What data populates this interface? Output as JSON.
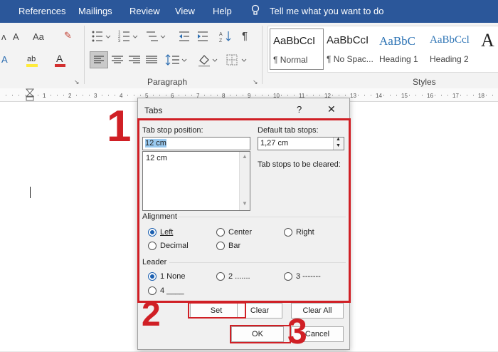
{
  "tabs": [
    "References",
    "Mailings",
    "Review",
    "View",
    "Help"
  ],
  "tell_me": "Tell me what you want to do",
  "ribbon": {
    "paragraph_label": "Paragraph",
    "styles_label": "Styles",
    "styles": [
      {
        "sample": "AaBbCcI",
        "name": "¶ Normal"
      },
      {
        "sample": "AaBbCcI",
        "name": "¶ No Spac..."
      },
      {
        "sample": "AaBbC",
        "name": "Heading 1"
      },
      {
        "sample": "AaBbCcl",
        "name": "Heading 2"
      },
      {
        "sample": "A",
        "name": ""
      }
    ],
    "font_aa": "Aa",
    "font_a": "A",
    "pilcrow": "¶"
  },
  "dialog": {
    "title": "Tabs",
    "help": "?",
    "close": "✕",
    "tab_stop_label": "Tab stop position:",
    "tab_stop_value": "12 cm",
    "tab_stop_list": [
      "12 cm"
    ],
    "default_label": "Default tab stops:",
    "default_value": "1,27 cm",
    "cleared_label": "Tab stops to be cleared:",
    "alignment_label": "Alignment",
    "alignment": [
      "Left",
      "Center",
      "Right",
      "Decimal",
      "Bar"
    ],
    "leader_label": "Leader",
    "leader": [
      "1 None",
      "2 .......",
      "3 -------",
      "4 ____"
    ],
    "set": "Set",
    "clear": "Clear",
    "clear_all": "Clear All",
    "ok": "OK",
    "cancel": "Cancel"
  },
  "annotations": {
    "n1": "1",
    "n2": "2",
    "n3": "3"
  },
  "colors": {
    "accent": "#2b579a",
    "highlight": "#d01f25",
    "radio": "#1b5fb0"
  }
}
